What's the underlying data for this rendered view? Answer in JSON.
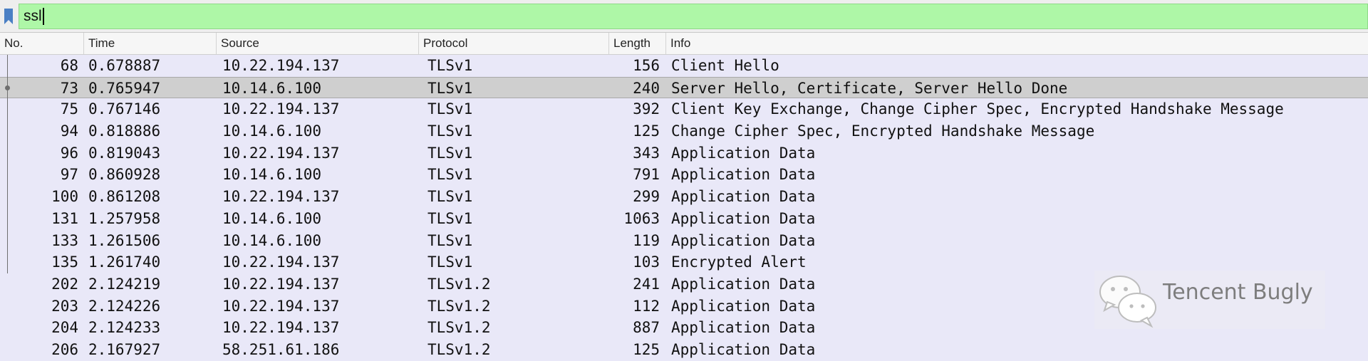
{
  "filter": {
    "value": "ssl"
  },
  "columns": {
    "no": "No.",
    "time": "Time",
    "source": "Source",
    "protocol": "Protocol",
    "length": "Length",
    "info": "Info"
  },
  "packets": [
    {
      "no": "68",
      "time": "0.678887",
      "source": "10.22.194.137",
      "protocol": "TLSv1",
      "length": "156",
      "info": "Client Hello"
    },
    {
      "no": "73",
      "time": "0.765947",
      "source": "10.14.6.100",
      "protocol": "TLSv1",
      "length": "240",
      "info": "Server Hello, Certificate, Server Hello Done"
    },
    {
      "no": "75",
      "time": "0.767146",
      "source": "10.22.194.137",
      "protocol": "TLSv1",
      "length": "392",
      "info": "Client Key Exchange, Change Cipher Spec, Encrypted Handshake Message"
    },
    {
      "no": "94",
      "time": "0.818886",
      "source": "10.14.6.100",
      "protocol": "TLSv1",
      "length": "125",
      "info": "Change Cipher Spec, Encrypted Handshake Message"
    },
    {
      "no": "96",
      "time": "0.819043",
      "source": "10.22.194.137",
      "protocol": "TLSv1",
      "length": "343",
      "info": "Application Data"
    },
    {
      "no": "97",
      "time": "0.860928",
      "source": "10.14.6.100",
      "protocol": "TLSv1",
      "length": "791",
      "info": "Application Data"
    },
    {
      "no": "100",
      "time": "0.861208",
      "source": "10.22.194.137",
      "protocol": "TLSv1",
      "length": "299",
      "info": "Application Data"
    },
    {
      "no": "131",
      "time": "1.257958",
      "source": "10.14.6.100",
      "protocol": "TLSv1",
      "length": "1063",
      "info": "Application Data"
    },
    {
      "no": "133",
      "time": "1.261506",
      "source": "10.14.6.100",
      "protocol": "TLSv1",
      "length": "119",
      "info": "Application Data"
    },
    {
      "no": "135",
      "time": "1.261740",
      "source": "10.22.194.137",
      "protocol": "TLSv1",
      "length": "103",
      "info": "Encrypted Alert"
    },
    {
      "no": "202",
      "time": "2.124219",
      "source": "10.22.194.137",
      "protocol": "TLSv1.2",
      "length": "241",
      "info": "Application Data"
    },
    {
      "no": "203",
      "time": "2.124226",
      "source": "10.22.194.137",
      "protocol": "TLSv1.2",
      "length": "112",
      "info": "Application Data"
    },
    {
      "no": "204",
      "time": "2.124233",
      "source": "10.22.194.137",
      "protocol": "TLSv1.2",
      "length": "887",
      "info": "Application Data"
    },
    {
      "no": "206",
      "time": "2.167927",
      "source": "58.251.61.186",
      "protocol": "TLSv1.2",
      "length": "125",
      "info": "Application Data"
    }
  ],
  "selected_row": 1,
  "watermark": {
    "text": "Tencent Bugly"
  },
  "colors": {
    "filter_bg": "#aef7a7",
    "row_bg": "#e9e8f8",
    "selected_bg": "#cfcfcf",
    "bookmark": "#4a7fc4"
  },
  "icons": {
    "bookmark": "bookmark-icon",
    "logo": "wechat-logo-icon"
  }
}
